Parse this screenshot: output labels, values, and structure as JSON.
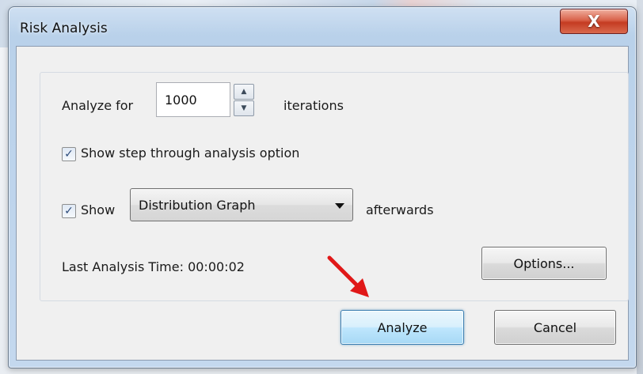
{
  "window": {
    "title": "Risk Analysis",
    "close_glyph": "X"
  },
  "iterations": {
    "prefix_label": "Analyze for",
    "value": "1000",
    "suffix_label": "iterations"
  },
  "step_through": {
    "checked": true,
    "label": "Show step through analysis option"
  },
  "show_after": {
    "checked": true,
    "label": "Show",
    "selected_option": "Distribution Graph",
    "suffix_label": "afterwards"
  },
  "last_analysis": {
    "label": "Last Analysis Time:",
    "value": "00:00:02"
  },
  "buttons": {
    "options_label": "Options...",
    "analyze_label": "Analyze",
    "cancel_label": "Cancel"
  },
  "icons": {
    "close": "close-icon",
    "spin_up": "spin-up-icon",
    "spin_down": "spin-down-icon",
    "checkmark": "checkmark-icon",
    "dropdown": "chevron-down-icon",
    "annotation": "red-arrow-icon"
  },
  "colors": {
    "default_button_border": "#3c7fb1",
    "annotation_arrow": "#e01818",
    "close_button": "#c43b22"
  }
}
